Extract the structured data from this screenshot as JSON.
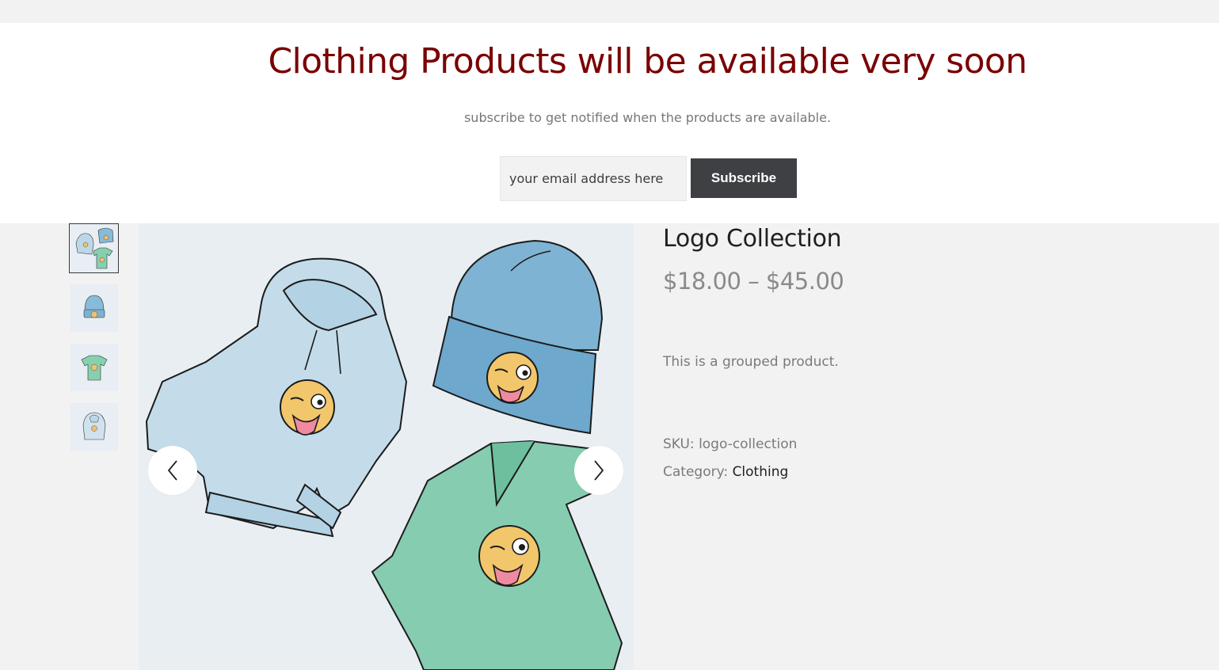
{
  "notice": {
    "title": "Clothing Products will be available very soon",
    "subtitle": "subscribe to get notified when the products are available.",
    "email_placeholder": "your email address here",
    "subscribe_label": "Subscribe"
  },
  "gallery": {
    "thumbnails": [
      {
        "icon": "hoodie-beanie-tshirt-thumbnail",
        "active": true
      },
      {
        "icon": "beanie-thumbnail",
        "active": false
      },
      {
        "icon": "tshirt-thumbnail",
        "active": false
      },
      {
        "icon": "hoodie-thumbnail",
        "active": false
      }
    ],
    "main_image_icon": "logo-collection-product-image",
    "prev_icon": "chevron-left-icon",
    "next_icon": "chevron-right-icon"
  },
  "product": {
    "title": "Logo Collection",
    "price": "$18.00 – $45.00",
    "description": "This is a grouped product.",
    "sku_label": "SKU:",
    "sku_value": "logo-collection",
    "category_label": "Category:",
    "category_value": "Clothing"
  },
  "colors": {
    "notice_title": "#7a0000",
    "subscribe_bg": "#3e4044",
    "page_bg": "#f2f2f2"
  }
}
